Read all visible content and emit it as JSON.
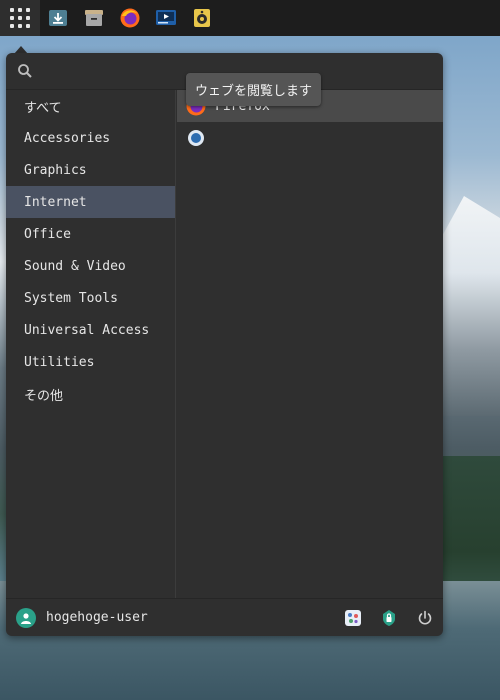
{
  "top_panel": {
    "launchers": [
      {
        "icon": "download-icon"
      },
      {
        "icon": "archive-manager-icon"
      },
      {
        "icon": "firefox-icon"
      },
      {
        "icon": "media-player-icon"
      },
      {
        "icon": "speaker-icon"
      }
    ]
  },
  "search": {
    "placeholder": ""
  },
  "categories": [
    {
      "label": "すべて",
      "active": false
    },
    {
      "label": "Accessories",
      "active": false
    },
    {
      "label": "Graphics",
      "active": false
    },
    {
      "label": "Internet",
      "active": true
    },
    {
      "label": "Office",
      "active": false
    },
    {
      "label": "Sound & Video",
      "active": false
    },
    {
      "label": "System Tools",
      "active": false
    },
    {
      "label": "Universal Access",
      "active": false
    },
    {
      "label": "Utilities",
      "active": false
    },
    {
      "label": "その他",
      "active": false
    }
  ],
  "apps": [
    {
      "label": "Firefox",
      "icon": "firefox-icon",
      "active": true
    },
    {
      "label": "",
      "icon": "network-app-icon",
      "active": false
    }
  ],
  "tooltip": {
    "text": "ウェブを閲覧します"
  },
  "footer": {
    "username": "hogehoge-user",
    "buttons": [
      "settings-icon",
      "lock-icon",
      "power-icon"
    ]
  },
  "colors": {
    "accent": "#4a5262",
    "panel": "#1d1d1d",
    "menu_bg": "#2f2f2f",
    "avatar": "#2aa189"
  }
}
